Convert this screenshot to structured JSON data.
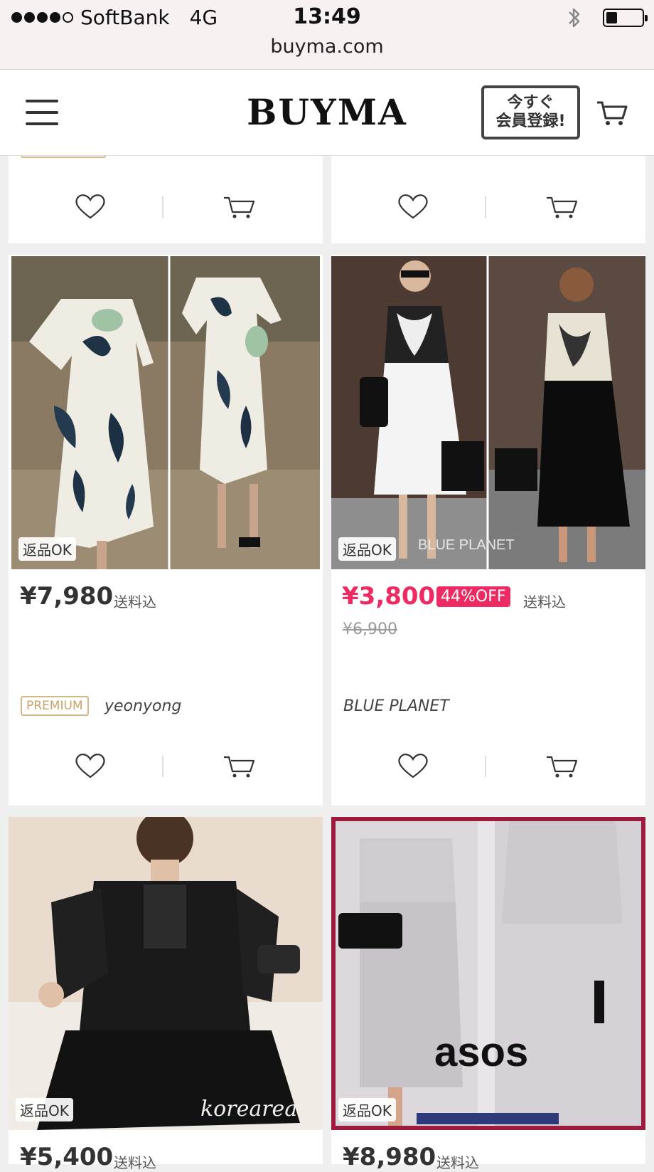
{
  "status_bar": {
    "carrier": "SoftBank",
    "network": "4G",
    "time": "13:49"
  },
  "browser": {
    "url": "buyma.com"
  },
  "header": {
    "logo": "BUYMA",
    "register_line1": "今すぐ",
    "register_line2": "会員登録!"
  },
  "products": [
    {
      "return_badge": "返品OK",
      "price": "¥7,980",
      "shipping": "送料込",
      "premium": "PREMIUM",
      "shop": "yeonyong"
    },
    {
      "return_badge": "返品OK",
      "price": "¥3,800",
      "discount": "44%OFF",
      "shipping": "送料込",
      "original_price": "¥6,900",
      "shop": "BLUE PLANET",
      "image_text": "BLUE PLANET"
    },
    {
      "return_badge": "返品OK",
      "price": "¥5,400",
      "shipping": "送料込",
      "image_text": "korearea"
    },
    {
      "return_badge": "返品OK",
      "price": "¥8,980",
      "shipping": "送料込",
      "image_text": "asos"
    }
  ],
  "colors": {
    "sale": "#ee2a63",
    "premium": "#c9a46a",
    "background": "#efeff0"
  },
  "icons": [
    "heart-icon",
    "cart-icon",
    "menu-icon",
    "bluetooth-icon",
    "battery-icon"
  ]
}
